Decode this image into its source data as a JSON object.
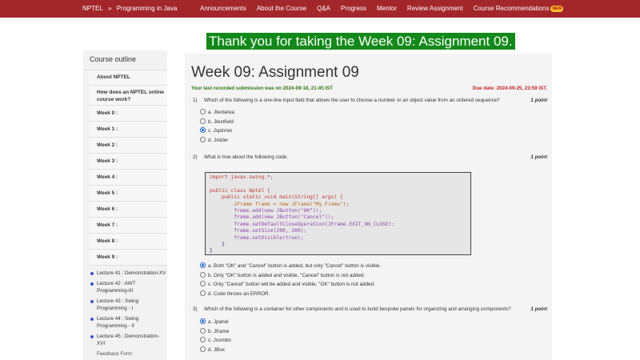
{
  "header": {
    "brand": "NPTEL",
    "separator": "»",
    "course": "Programming in Java",
    "nav": [
      "Announcements",
      "About the Course",
      "Q&A",
      "Progress",
      "Mentor",
      "Review Assignment",
      "Course Recommendations"
    ],
    "new_badge": "NEW"
  },
  "banner": "Thank you for taking the Week 09: Assignment 09.",
  "sidebar": {
    "title": "Course outline",
    "items": [
      "About NPTEL",
      "How does an NPTEL online course work?",
      "Week 0 :",
      "Week 1 :",
      "Week 2 :",
      "Week 3 :",
      "Week 4 :",
      "Week 5 :",
      "Week 6 :",
      "Week 7 :",
      "Week 8 :",
      "Week 9 :"
    ],
    "subitems": [
      "Lecture 41 : Demonstration-XV",
      "Lecture 42 : AWT Programming-III",
      "Lecture 43 : Swing Programming - I",
      "Lecture 44 : Swing Programming - II",
      "Lecture 45 : Demonstration-XVI"
    ],
    "feedback": "Feedback Form"
  },
  "assignment": {
    "title": "Week 09: Assignment 09",
    "last_submission": "Your last recorded submission was on 2024-09-18, 21:45 IST",
    "due": "Due date: 2024-09-25, 23:59 IST.",
    "questions": [
      {
        "num": "1)",
        "text": "Which of the following is a one-line input field that allows the user to choose a number or an object value from an ordered sequence?",
        "points": "1 point",
        "options": [
          "a. Jtextarea",
          "b. Jtextfield",
          "c. Jspinner",
          "d. Jslider"
        ],
        "selected": 2
      },
      {
        "num": "2)",
        "text": "What is true about the following code.",
        "points": "1 point",
        "options": [
          "a. Both \"OK\" and \"Cancel\" button is added, but only \"Cancel\" button is visible.",
          "b. Only \"OK\" button is added and visible, \"Cancel\" button is not added.",
          "c. Only \"Cancel\" button will be added and visible, \"OK\" button is not added.",
          "d. Code throws an ERROR."
        ],
        "selected": 0
      },
      {
        "num": "3)",
        "text": "Which of the following is a container for other components and is used to build bespoke panels for organizing and arranging components?",
        "points": "1 point",
        "options": [
          "a. Jpanel",
          "b. Jframe",
          "c. Jcombo",
          "d. JBox"
        ],
        "selected": 0
      }
    ],
    "code_lines": [
      "import javax.swing.*;",
      "",
      "public class Nptel {",
      "    public static void main(String[] args) {",
      "        JFrame frame = new JFrame(\"My Frame\");",
      "        frame.add(new JButton(\"OK\"));",
      "        frame.add(new JButton(\"Cancel\"));",
      "        frame.setDefaultCloseOperation(JFrame.EXIT_ON_CLOSE);",
      "        frame.setSize(200, 200);",
      "        frame.setVisible(true);",
      "    }",
      "}"
    ]
  },
  "colors": {
    "header": "#a2262a",
    "banner": "#12891a",
    "accent": "#1a64d6"
  }
}
